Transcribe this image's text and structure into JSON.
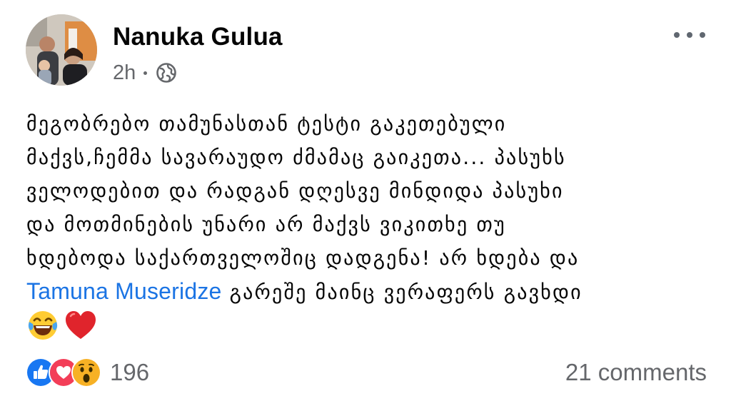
{
  "post": {
    "author": "Nanuka Gulua",
    "time": "2h",
    "privacy_icon": "globe-icon",
    "more_icon": "more-options-icon",
    "lines": [
      "მეგობრებო თამუნასთან ტესტი გაკეთებული",
      "მაქვს,ჩემმა სავარაუდო ძმამაც გაიკეთა... პასუხს",
      "ველოდებით და რადგან დღესვე მინდიდა პასუხი",
      "და მოთმინების უნარი არ მაქვს ვიკითხე თუ",
      "ხდებოდა საქართველოშიც დადგენა! არ ხდება და"
    ],
    "mention": "Tamuna Museridze",
    "after_mention": " გარეშე მაინც ვერაფერს გავხდი",
    "emojis": [
      "laughing-tears-emoji",
      "red-heart-emoji"
    ],
    "reactions": {
      "icons": [
        "like-icon",
        "love-icon",
        "wow-icon"
      ],
      "count": "196"
    },
    "comments": "21 comments"
  },
  "colors": {
    "mention": "#1b74e4",
    "secondary_text": "#65676b",
    "like": "#1877f2",
    "love": "#f33e58",
    "wow": "#f7b125"
  }
}
